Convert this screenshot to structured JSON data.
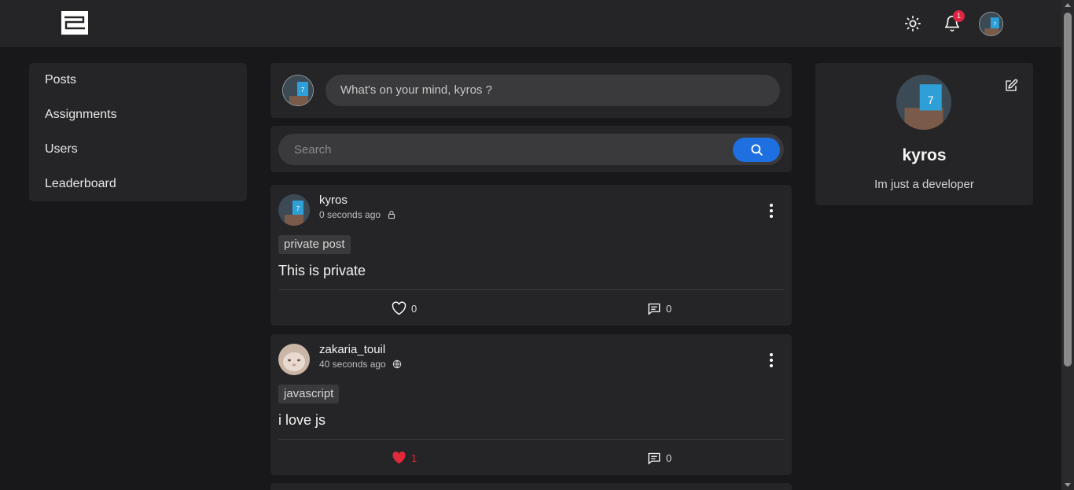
{
  "header": {
    "notification_count": "1"
  },
  "sidebar": {
    "items": [
      {
        "label": "Posts"
      },
      {
        "label": "Assignments"
      },
      {
        "label": "Users"
      },
      {
        "label": "Leaderboard"
      }
    ]
  },
  "composer": {
    "prompt": "What's on your mind, kyros ?"
  },
  "search": {
    "placeholder": "Search"
  },
  "posts": [
    {
      "author": "kyros",
      "time": "0 seconds ago",
      "visibility_icon": "lock-icon",
      "tag": "private post",
      "content": "This is private",
      "likes": "0",
      "comments": "0",
      "liked": false
    },
    {
      "author": "zakaria_touil",
      "time": "40 seconds ago",
      "visibility_icon": "globe-icon",
      "tag": "javascript",
      "content": "i love js",
      "likes": "1",
      "comments": "0",
      "liked": true
    }
  ],
  "profile": {
    "name": "kyros",
    "bio": "Im just a developer"
  },
  "colors": {
    "background": "#18181a",
    "panel": "#252527",
    "accent": "#1e6fe0",
    "like": "#e02a3c",
    "badge": "#e02443"
  }
}
